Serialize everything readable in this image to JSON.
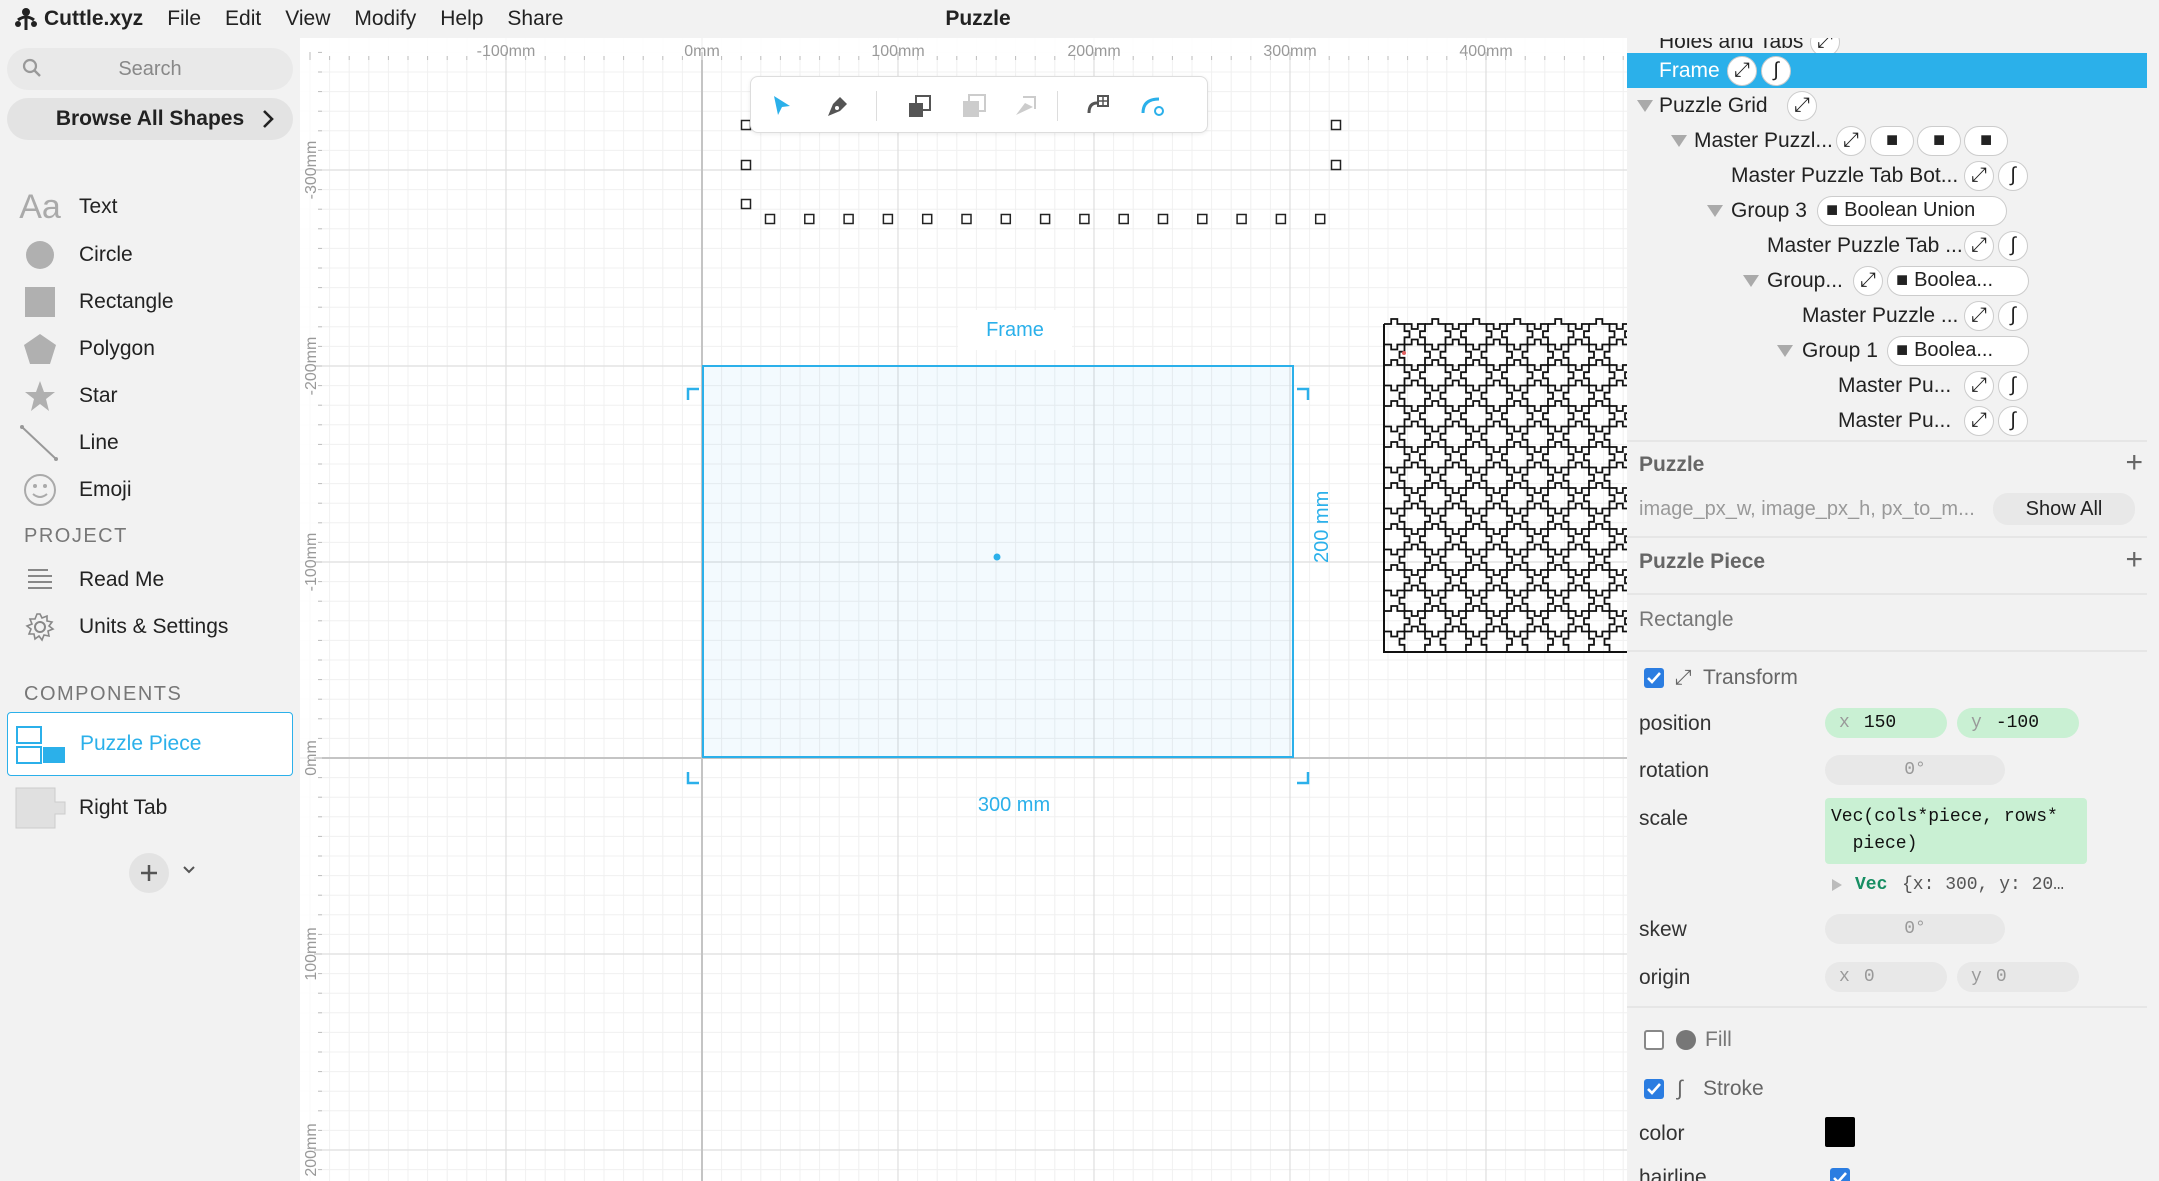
{
  "app": {
    "name": "Cuttle.xyz",
    "menu": [
      "File",
      "Edit",
      "View",
      "Modify",
      "Help",
      "Share"
    ],
    "document_title": "Puzzle"
  },
  "left_sidebar": {
    "search_placeholder": "Search",
    "browse_label": "Browse All Shapes",
    "text_icon_glyph": "Aa",
    "shapes": [
      {
        "label": "Text",
        "icon": "text-icon"
      },
      {
        "label": "Circle",
        "icon": "circle-icon"
      },
      {
        "label": "Rectangle",
        "icon": "rectangle-icon"
      },
      {
        "label": "Polygon",
        "icon": "polygon-icon"
      },
      {
        "label": "Star",
        "icon": "star-icon"
      },
      {
        "label": "Line",
        "icon": "line-icon"
      },
      {
        "label": "Emoji",
        "icon": "emoji-icon"
      }
    ],
    "project_title": "PROJECT",
    "project_items": [
      {
        "label": "Read Me",
        "icon": "readme-icon"
      },
      {
        "label": "Units & Settings",
        "icon": "gear-icon"
      }
    ],
    "components_title": "COMPONENTS",
    "components": [
      {
        "label": "Puzzle Piece",
        "selected": true
      },
      {
        "label": "Right Tab",
        "selected": false
      }
    ]
  },
  "canvas": {
    "ruler_top": [
      "-100mm",
      "0mm",
      "100mm",
      "200mm",
      "300mm",
      "400mm"
    ],
    "ruler_left": [
      "-300mm",
      "-200mm",
      "-100mm",
      "0mm",
      "100mm",
      "200mm"
    ],
    "frame_label": "Frame",
    "width_label": "300 mm",
    "height_label": "200 mm",
    "accent_color": "#2bb0ea"
  },
  "right_panel": {
    "tree": {
      "items": [
        {
          "label": "Holes and Tabs"
        },
        {
          "label": "Frame"
        },
        {
          "label": "Puzzle Grid"
        },
        {
          "label": "Master Puzzl..."
        },
        {
          "label": "Master Puzzle Tab Bot..."
        },
        {
          "label": "Group 3",
          "badge": "Boolean Union"
        },
        {
          "label": "Master Puzzle Tab ..."
        },
        {
          "label": "Group...",
          "badge": "Boolea..."
        },
        {
          "label": "Master Puzzle ..."
        },
        {
          "label": "Group 1",
          "badge": "Boolea..."
        },
        {
          "label": "Master Pu..."
        },
        {
          "label": "Master Pu..."
        }
      ]
    },
    "puzzle_section": {
      "title": "Puzzle",
      "params": "image_px_w, image_px_h, px_to_m...",
      "show_all": "Show All"
    },
    "puzzle_piece_section": {
      "title": "Puzzle Piece",
      "shape": "Rectangle"
    },
    "transform": {
      "title": "Transform",
      "position_label": "position",
      "position_x_key": "x",
      "position_x": "150",
      "position_y_key": "y",
      "position_y": "-100",
      "rotation_label": "rotation",
      "rotation": "0°",
      "scale_label": "scale",
      "scale_expr": "Vec(cols*piece, rows*\n  piece)",
      "scale_result_type": "Vec",
      "scale_result": "{x: 300, y: 20…",
      "skew_label": "skew",
      "skew": "0°",
      "origin_label": "origin",
      "origin_x_key": "x",
      "origin_x": "0",
      "origin_y_key": "y",
      "origin_y": "0"
    },
    "fill": {
      "title": "Fill",
      "enabled": false
    },
    "stroke": {
      "title": "Stroke",
      "enabled": true,
      "color_label": "color",
      "color": "#000000",
      "hairline_label": "hairline"
    }
  }
}
